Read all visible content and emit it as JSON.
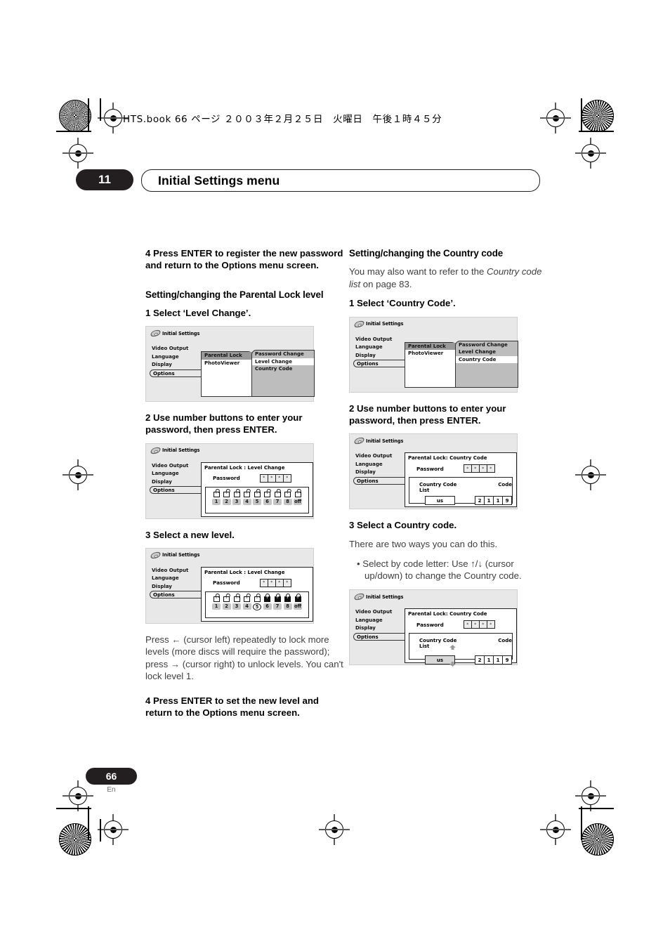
{
  "header": {
    "print_line": "HTS.book  66 ページ  ２００３年２月２５日　火曜日　午後１時４５分",
    "chapter_number": "11",
    "chapter_title": "Initial Settings menu"
  },
  "footer": {
    "page_number": "66",
    "language": "En"
  },
  "left_column": {
    "step4_password": "4    Press ENTER to register the new password and return to the Options menu screen.",
    "heading_parental": "Setting/changing the Parental Lock level",
    "step1": "1    Select ‘Level Change’.",
    "step2": "2    Use number buttons to enter your password, then press ENTER.",
    "step3": "3    Select a new level.",
    "note": "Press ← (cursor left) repeatedly to lock more levels (more discs will require the password); press → (cursor right) to unlock levels. You can't lock level 1.",
    "step4_level": "4    Press ENTER to set the new level and return to the Options menu screen."
  },
  "right_column": {
    "heading_country": "Setting/changing the Country code",
    "intro_a": "You may also want to refer to the ",
    "intro_italic": "Country code list",
    "intro_b": " on page 83.",
    "step1": "1    Select ‘Country Code’.",
    "step2": "2    Use number buttons to enter your password, then press ENTER.",
    "step3": "3    Select a Country code.",
    "step3_note": "There are two ways you can do this.",
    "bullet1": "•  Select by code letter: Use ↑/↓ (cursor up/down) to change the Country code."
  },
  "osd": {
    "title": "Initial Settings",
    "left_menu": [
      "Video Output",
      "Language",
      "Display"
    ],
    "options_label": "Options",
    "mid_menu": [
      "Parental Lock",
      "PhotoViewer"
    ],
    "right_menu": [
      "Password Change",
      "Level Change",
      "Country Code"
    ],
    "level_title": "Parental Lock : Level Change",
    "country_title": "Parental Lock: Country Code",
    "password_label": "Password",
    "password_chars": [
      "*",
      "*",
      "*",
      "*"
    ],
    "level_numbers": [
      "1",
      "2",
      "3",
      "4",
      "5",
      "6",
      "7",
      "8",
      "off"
    ],
    "country_list_label": "Country Code List",
    "code_label": "Code",
    "country_value": "us",
    "code_digits": [
      "2",
      "1",
      "1",
      "9"
    ]
  },
  "osd_states": {
    "diagram1_selected": "Level Change",
    "diagram4_selected": "Country Code",
    "diagram2_locks": [
      "open",
      "open",
      "open",
      "open",
      "open",
      "open",
      "open",
      "open",
      "open"
    ],
    "diagram3_locks": [
      "open",
      "open",
      "open",
      "open",
      "open",
      "closed",
      "closed",
      "closed",
      "closed"
    ],
    "diagram3_circled": "5"
  }
}
